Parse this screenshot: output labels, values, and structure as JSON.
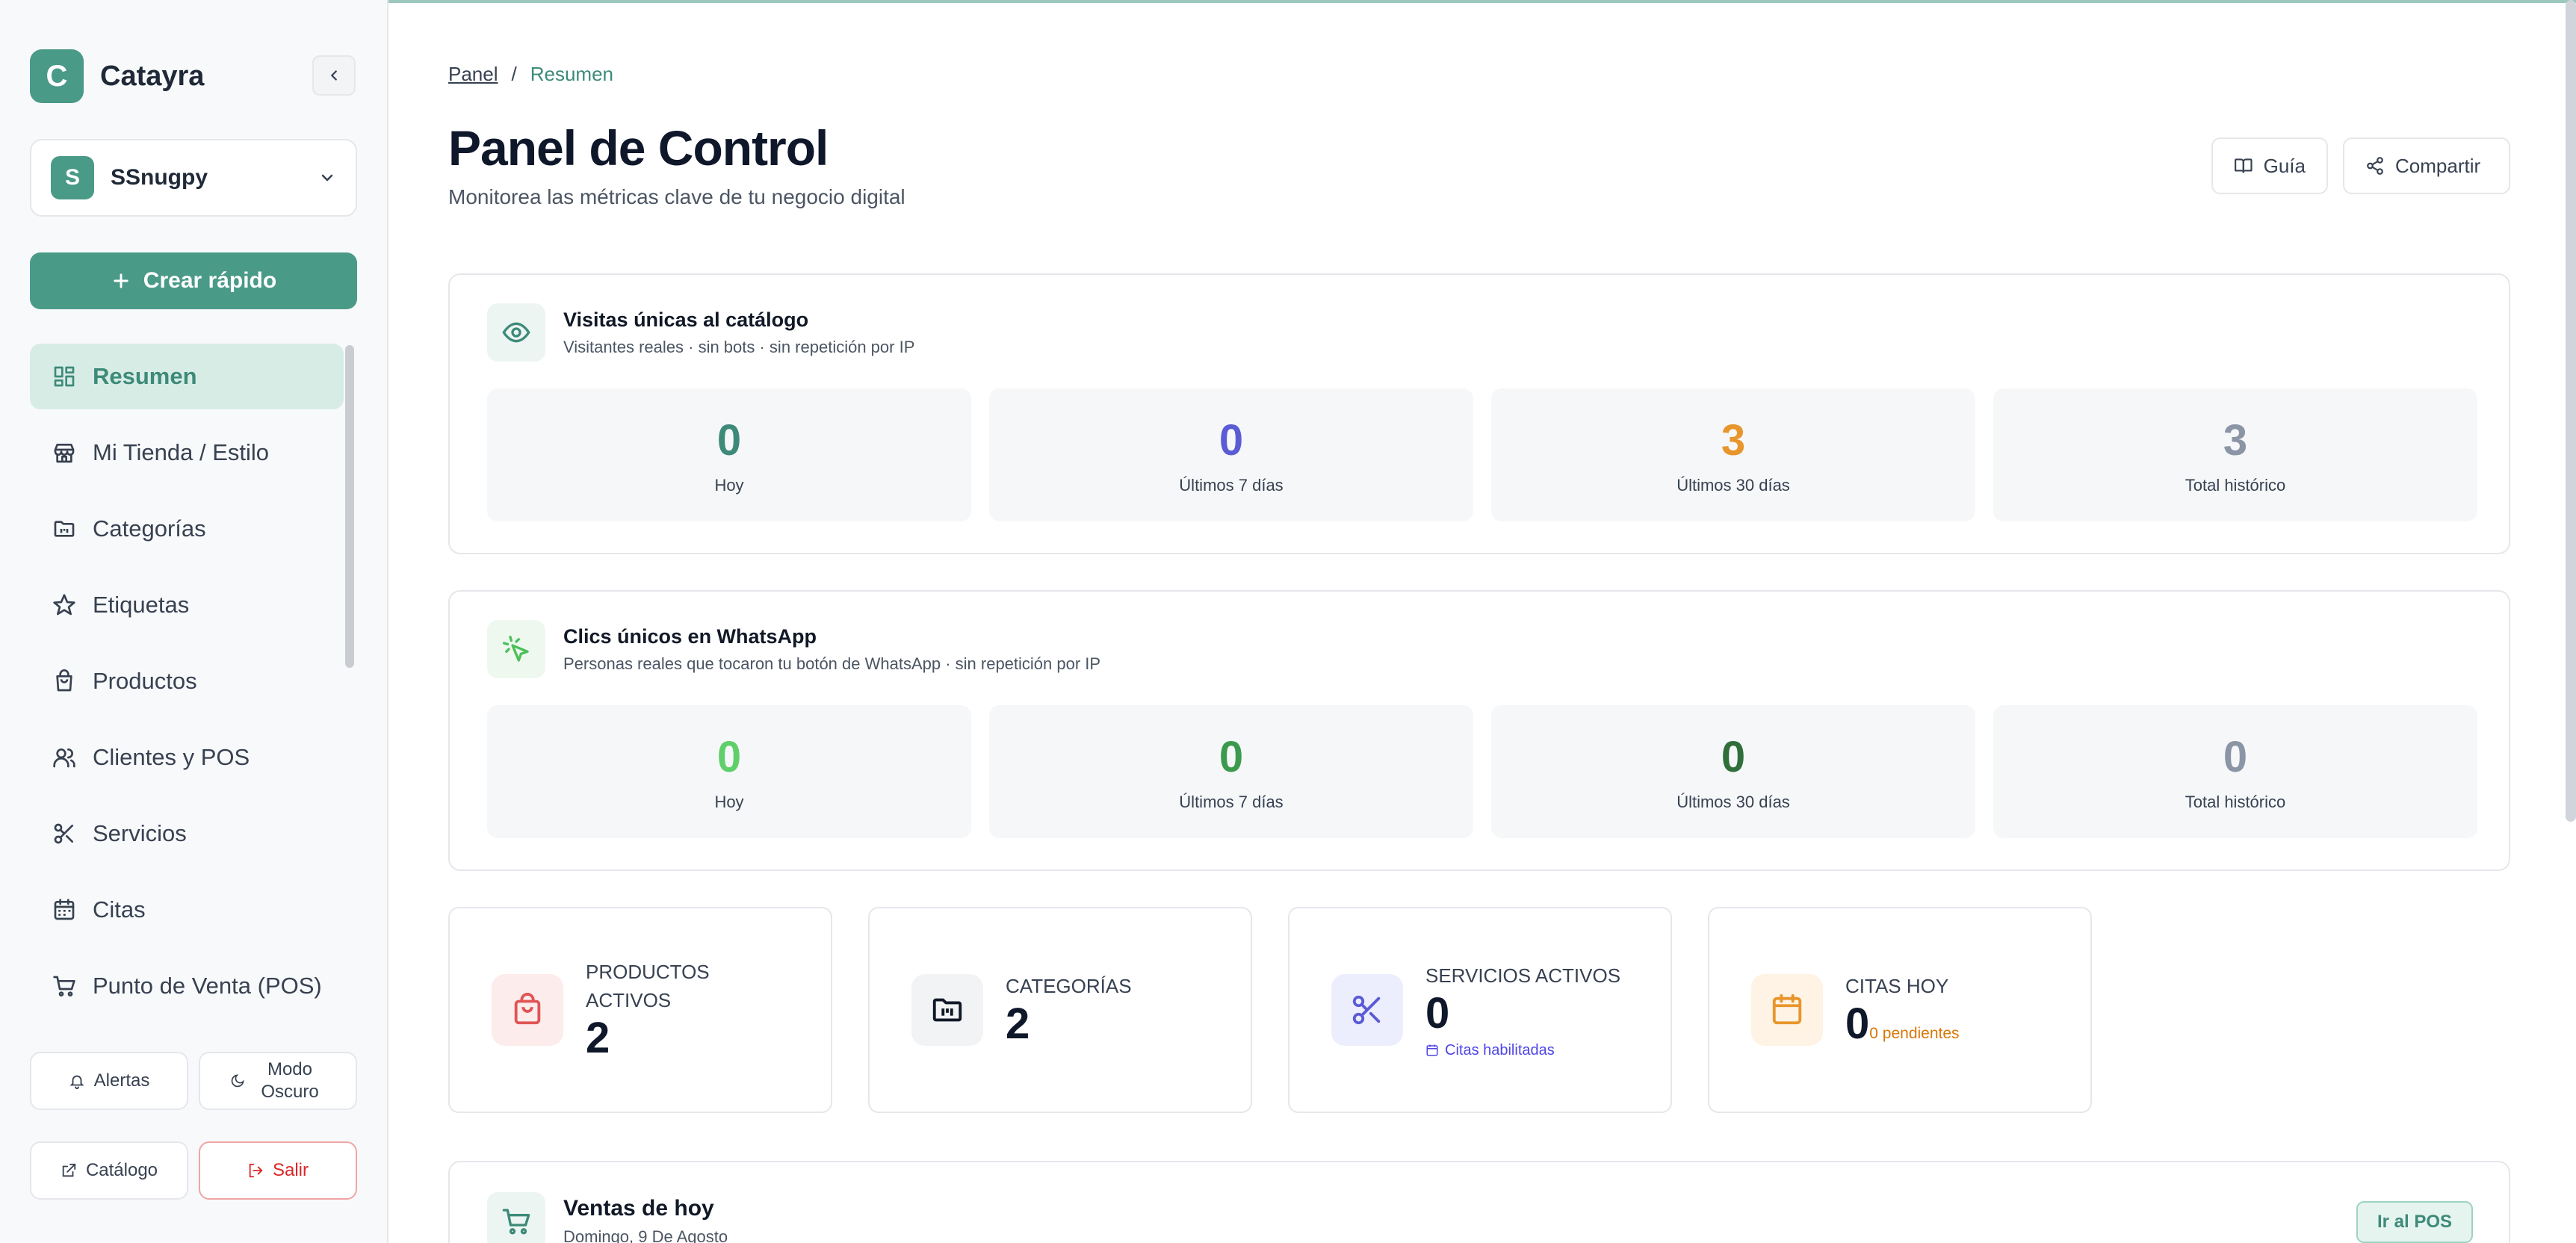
{
  "app": {
    "name": "Catayra",
    "logo_letter": "C"
  },
  "store": {
    "name": "SSnugpy",
    "avatar": "S"
  },
  "quick_create": {
    "label": "Crear rápido"
  },
  "sidebar": {
    "items": [
      {
        "label": "Resumen",
        "icon": "grid-icon",
        "active": true
      },
      {
        "label": "Mi Tienda / Estilo",
        "icon": "store-icon"
      },
      {
        "label": "Categorías",
        "icon": "folder-icon"
      },
      {
        "label": "Etiquetas",
        "icon": "star-icon"
      },
      {
        "label": "Productos",
        "icon": "bag-icon"
      },
      {
        "label": "Clientes y POS",
        "icon": "users-icon"
      },
      {
        "label": "Servicios",
        "icon": "scissors-icon"
      },
      {
        "label": "Citas",
        "icon": "calendar-icon"
      },
      {
        "label": "Punto de Venta (POS)",
        "icon": "cart-icon"
      }
    ],
    "footer": {
      "alerts": "Alertas",
      "dark_mode": "Modo Oscuro",
      "catalog": "Catálogo",
      "logout": "Salir"
    }
  },
  "breadcrumb": {
    "root": "Panel",
    "separator": "/",
    "current": "Resumen"
  },
  "header": {
    "title": "Panel de Control",
    "subtitle": "Monitorea las métricas clave de tu negocio digital",
    "guide": "Guía",
    "share": "Compartir"
  },
  "visits": {
    "title": "Visitas únicas al catálogo",
    "desc": "Visitantes reales · sin bots · sin repetición por IP",
    "stats": [
      {
        "value": "0",
        "label": "Hoy",
        "color": "#3d8a79"
      },
      {
        "value": "0",
        "label": "Últimos 7 días",
        "color": "#5b5bd6"
      },
      {
        "value": "3",
        "label": "Últimos 30 días",
        "color": "#e8952c"
      },
      {
        "value": "3",
        "label": "Total histórico",
        "color": "#8b95a5"
      }
    ]
  },
  "whatsapp": {
    "title": "Clics únicos en WhatsApp",
    "desc": "Personas reales que tocaron tu botón de WhatsApp · sin repetición por IP",
    "stats": [
      {
        "value": "0",
        "label": "Hoy",
        "color": "#5fcf6a"
      },
      {
        "value": "0",
        "label": "Últimos 7 días",
        "color": "#3c9a4e"
      },
      {
        "value": "0",
        "label": "Últimos 30 días",
        "color": "#2f6f3a"
      },
      {
        "value": "0",
        "label": "Total histórico",
        "color": "#8b95a5"
      }
    ]
  },
  "summary": {
    "products": {
      "label_line1": "Productos",
      "label_line2": "Activos",
      "value": "2"
    },
    "categories": {
      "label": "Categorías",
      "value": "2"
    },
    "services": {
      "label": "Servicios Activos",
      "value": "0",
      "note": "Citas habilitadas"
    },
    "appointments": {
      "label": "Citas Hoy",
      "value": "0",
      "pending": "0 pendientes"
    }
  },
  "sales": {
    "title": "Ventas de hoy",
    "date": "Domingo, 9 De Agosto",
    "pos_button": "Ir al POS"
  }
}
